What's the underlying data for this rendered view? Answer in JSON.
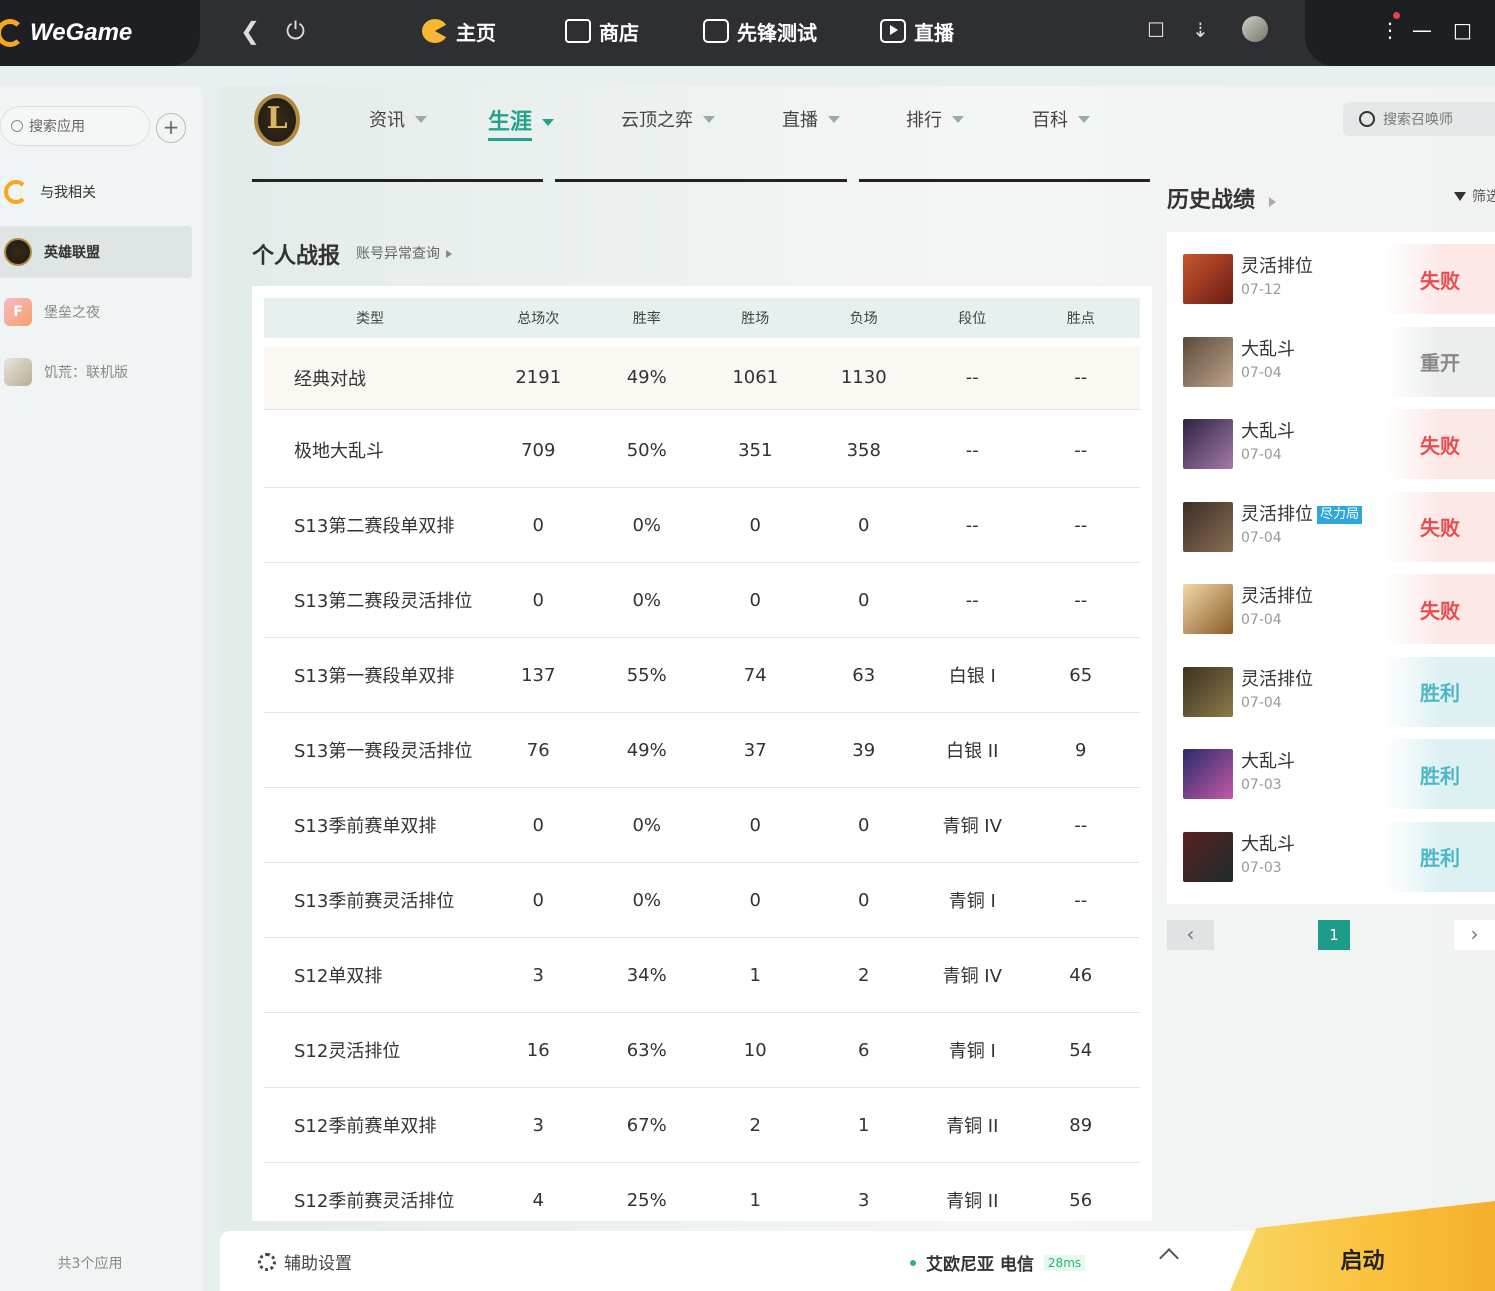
{
  "app": {
    "brand": "WeGame"
  },
  "topnav": [
    {
      "label": "主页",
      "icon": "pacman-icon"
    },
    {
      "label": "商店",
      "icon": "shopping-bag-icon"
    },
    {
      "label": "先锋测试",
      "icon": "flash-test-icon"
    },
    {
      "label": "直播",
      "icon": "play-icon"
    }
  ],
  "sidebar": {
    "search_placeholder": "搜索应用",
    "items": [
      {
        "label": "与我相关"
      },
      {
        "label": "英雄联盟"
      },
      {
        "label": "堡垒之夜"
      },
      {
        "label": "饥荒：联机版"
      }
    ],
    "footer": "共3个应用"
  },
  "subnav": [
    {
      "label": "资讯"
    },
    {
      "label": "生涯"
    },
    {
      "label": "云顶之弈"
    },
    {
      "label": "直播"
    },
    {
      "label": "排行"
    },
    {
      "label": "百科"
    }
  ],
  "summoner_search_placeholder": "搜索召唤师",
  "section": {
    "title": "个人战报",
    "link": "账号异常查询"
  },
  "table": {
    "headers": [
      "类型",
      "总场次",
      "胜率",
      "胜场",
      "负场",
      "段位",
      "胜点"
    ],
    "rows": [
      [
        "经典对战",
        "2191",
        "49%",
        "1061",
        "1130",
        "--",
        "--"
      ],
      [
        "极地大乱斗",
        "709",
        "50%",
        "351",
        "358",
        "--",
        "--"
      ],
      [
        "S13第二赛段单双排",
        "0",
        "0%",
        "0",
        "0",
        "--",
        "--"
      ],
      [
        "S13第二赛段灵活排位",
        "0",
        "0%",
        "0",
        "0",
        "--",
        "--"
      ],
      [
        "S13第一赛段单双排",
        "137",
        "55%",
        "74",
        "63",
        "白银 I",
        "65"
      ],
      [
        "S13第一赛段灵活排位",
        "76",
        "49%",
        "37",
        "39",
        "白银 II",
        "9"
      ],
      [
        "S13季前赛单双排",
        "0",
        "0%",
        "0",
        "0",
        "青铜 IV",
        "--"
      ],
      [
        "S13季前赛灵活排位",
        "0",
        "0%",
        "0",
        "0",
        "青铜 I",
        "--"
      ],
      [
        "S12单双排",
        "3",
        "34%",
        "1",
        "2",
        "青铜 IV",
        "46"
      ],
      [
        "S12灵活排位",
        "16",
        "63%",
        "10",
        "6",
        "青铜 I",
        "54"
      ],
      [
        "S12季前赛单双排",
        "3",
        "67%",
        "2",
        "1",
        "青铜 II",
        "89"
      ],
      [
        "S12季前赛灵活排位",
        "4",
        "25%",
        "1",
        "3",
        "青铜 II",
        "56"
      ]
    ]
  },
  "history": {
    "title": "历史战绩",
    "filter": "筛选",
    "items": [
      {
        "mode": "灵活排位",
        "date": "07-12",
        "result": "失败",
        "type": "lose",
        "tag": ""
      },
      {
        "mode": "大乱斗",
        "date": "07-04",
        "result": "重开",
        "type": "remake",
        "tag": ""
      },
      {
        "mode": "大乱斗",
        "date": "07-04",
        "result": "失败",
        "type": "lose",
        "tag": ""
      },
      {
        "mode": "灵活排位",
        "date": "07-04",
        "result": "失败",
        "type": "lose",
        "tag": "尽力局"
      },
      {
        "mode": "灵活排位",
        "date": "07-04",
        "result": "失败",
        "type": "lose",
        "tag": ""
      },
      {
        "mode": "灵活排位",
        "date": "07-04",
        "result": "胜利",
        "type": "win",
        "tag": ""
      },
      {
        "mode": "大乱斗",
        "date": "07-03",
        "result": "胜利",
        "type": "win",
        "tag": ""
      },
      {
        "mode": "大乱斗",
        "date": "07-03",
        "result": "胜利",
        "type": "win",
        "tag": ""
      }
    ],
    "page": "1"
  },
  "bottom": {
    "assist": "辅助设置",
    "server": "艾欧尼亚 电信",
    "ping": "28ms",
    "launch": "启动"
  },
  "colors": {
    "accent": "#22a38a",
    "lose": "#e94c4c",
    "win": "#4cb7c8",
    "launch": "#fbc03a"
  }
}
